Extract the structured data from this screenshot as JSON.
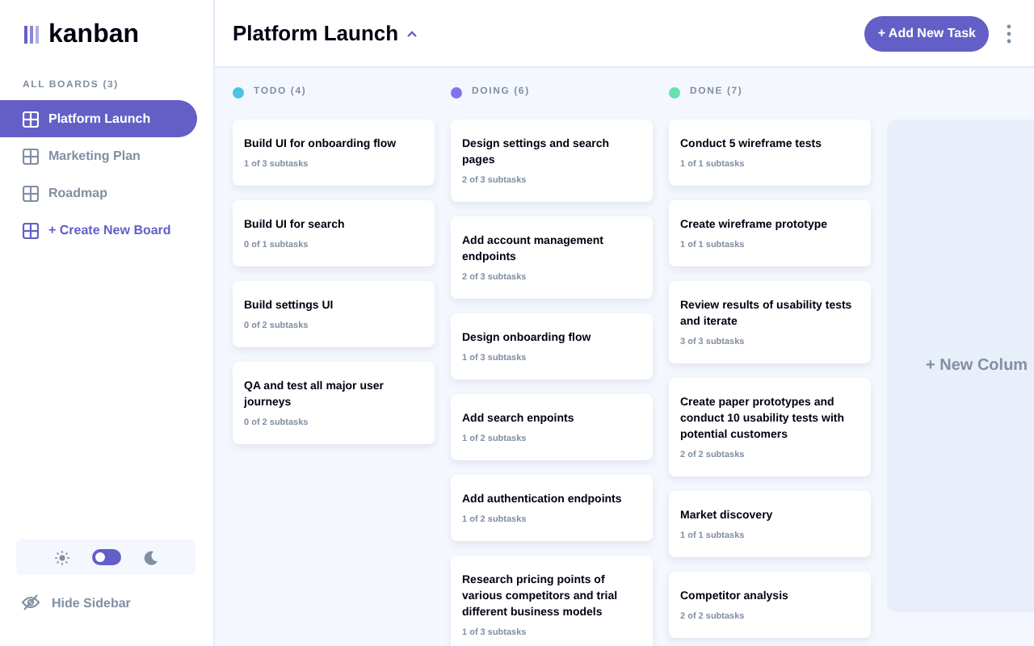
{
  "sidebar": {
    "logo": "kanban",
    "boards_heading": "ALL BOARDS (3)",
    "boards": [
      {
        "label": "Platform Launch",
        "selected": true
      },
      {
        "label": "Marketing Plan",
        "selected": false
      },
      {
        "label": "Roadmap",
        "selected": false
      }
    ],
    "create_board": "+ Create New Board",
    "theme_toggle": {
      "dark": false
    },
    "hide_sidebar": "Hide Sidebar"
  },
  "header": {
    "title": "Platform Launch",
    "add_task": "+ Add New Task"
  },
  "columns": [
    {
      "name": "TODO (4)",
      "color": "#49c4e5",
      "tasks": [
        {
          "title": "Build UI for onboarding flow",
          "subtasks": "1 of 3 subtasks"
        },
        {
          "title": "Build UI for search",
          "subtasks": "0 of 1 subtasks"
        },
        {
          "title": "Build settings UI",
          "subtasks": "0 of 2 subtasks"
        },
        {
          "title": "QA and test all major user journeys",
          "subtasks": "0 of 2 subtasks"
        }
      ]
    },
    {
      "name": "DOING (6)",
      "color": "#8471f2",
      "tasks": [
        {
          "title": "Design settings and search pages",
          "subtasks": "2 of 3 subtasks"
        },
        {
          "title": "Add account management endpoints",
          "subtasks": "2 of 3 subtasks"
        },
        {
          "title": "Design onboarding flow",
          "subtasks": "1 of 3 subtasks"
        },
        {
          "title": "Add search enpoints",
          "subtasks": "1 of 2 subtasks"
        },
        {
          "title": "Add authentication endpoints",
          "subtasks": "1 of 2 subtasks"
        },
        {
          "title": "Research pricing points of various competitors and trial different business models",
          "subtasks": "1 of 3 subtasks"
        }
      ]
    },
    {
      "name": "DONE (7)",
      "color": "#67e2ae",
      "tasks": [
        {
          "title": "Conduct 5 wireframe tests",
          "subtasks": "1 of 1 subtasks"
        },
        {
          "title": "Create wireframe prototype",
          "subtasks": "1 of 1 subtasks"
        },
        {
          "title": "Review results of usability tests and iterate",
          "subtasks": "3 of 3 subtasks"
        },
        {
          "title": "Create paper prototypes and conduct 10 usability tests with potential customers",
          "subtasks": "2 of 2 subtasks"
        },
        {
          "title": "Market discovery",
          "subtasks": "1 of 1 subtasks"
        },
        {
          "title": "Competitor analysis",
          "subtasks": "2 of 2 subtasks"
        }
      ]
    }
  ],
  "new_column": "+ New Colum"
}
